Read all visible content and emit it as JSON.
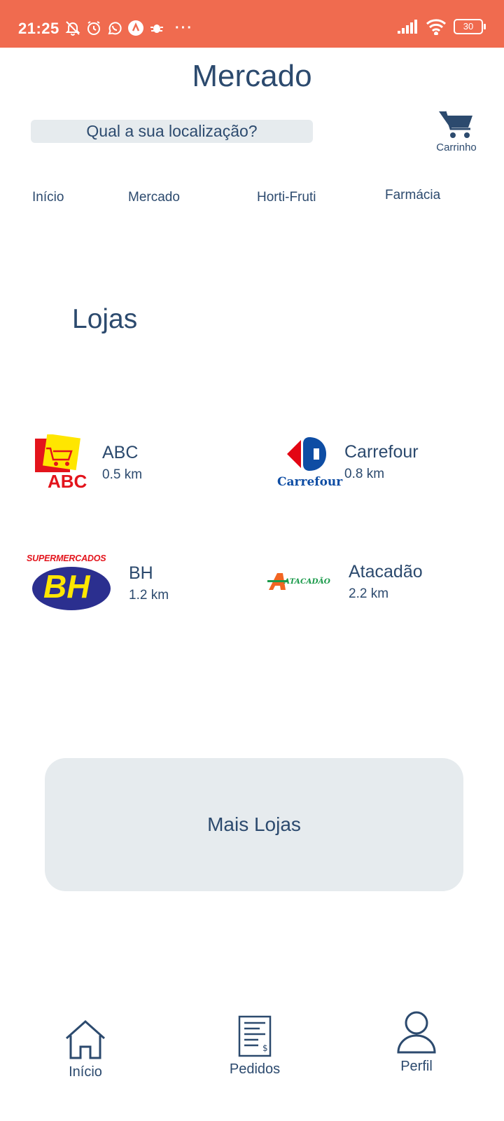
{
  "status_bar": {
    "time": "21:25",
    "battery": "30",
    "icons": [
      "bell-off-icon",
      "alarm-icon",
      "whatsapp-icon",
      "app-icon",
      "bug-icon",
      "more-dots-icon",
      "signal-icon",
      "wifi-icon",
      "battery-icon"
    ]
  },
  "header": {
    "title": "Mercado",
    "location_prompt": "Qual a sua localização?",
    "cart_label": "Carrinho"
  },
  "categories": [
    "Início",
    "Mercado",
    "Horti-Fruti",
    "Farmácia"
  ],
  "stores_section": {
    "title": "Lojas",
    "stores": [
      {
        "name": "ABC",
        "distance": "0.5 km",
        "logo_text": "ABC"
      },
      {
        "name": "Carrefour",
        "distance": "0.8 km",
        "logo_text": "Carrefour"
      },
      {
        "name": "BH",
        "distance": "1.2 km",
        "logo_text": "BH",
        "logo_top_text": "SUPERMERCADOS"
      },
      {
        "name": "Atacadão",
        "distance": "2.2 km",
        "logo_text": "ATACADÃO"
      }
    ],
    "more_button": "Mais Lojas"
  },
  "bottom_nav": [
    {
      "label": "Início",
      "icon": "home-icon"
    },
    {
      "label": "Pedidos",
      "icon": "receipt-icon"
    },
    {
      "label": "Perfil",
      "icon": "user-icon"
    }
  ],
  "colors": {
    "status_bar": "#f06b4f",
    "primary_text": "#2c4a6e",
    "surface": "#e6ebee"
  }
}
